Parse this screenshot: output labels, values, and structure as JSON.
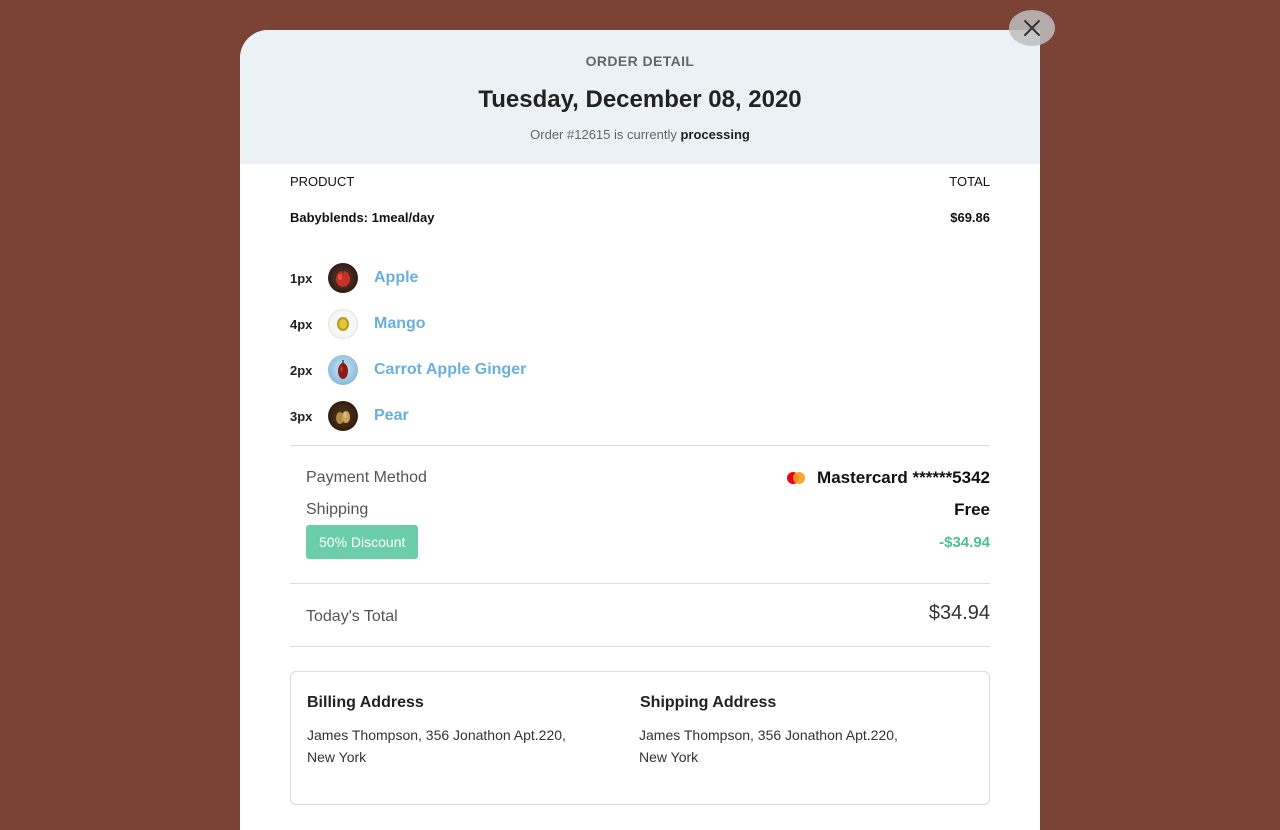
{
  "header": {
    "label": "ORDER DETAIL",
    "date": "Tuesday, December 08, 2020",
    "status_prefix": "Order #12615 is currently",
    "status": "processing"
  },
  "table": {
    "col_product": "PRODUCT",
    "col_total": "TOTAL",
    "product_name": "Babyblends: 1meal/day",
    "product_total": "$69.86"
  },
  "items": [
    {
      "qty": "1px",
      "name": "Apple",
      "icon": "apple-icon"
    },
    {
      "qty": "4px",
      "name": "Mango",
      "icon": "mango-icon"
    },
    {
      "qty": "2px",
      "name": "Carrot Apple Ginger",
      "icon": "carrot-icon"
    },
    {
      "qty": "3px",
      "name": "Pear",
      "icon": "pear-icon"
    }
  ],
  "summary": {
    "payment_label": "Payment Method",
    "payment_brand": "Mastercard",
    "payment_number": "******5342",
    "shipping_label": "Shipping",
    "shipping_value": "Free",
    "discount_label": "50% Discount",
    "discount_value": "-$34.94",
    "total_label": "Today's Total",
    "total_value": "$34.94"
  },
  "addresses": {
    "billing_title": "Billing Address",
    "billing_text": "James Thompson, 356 Jonathon Apt.220, New York",
    "shipping_title": "Shipping Address",
    "shipping_text": "James Thompson, 356 Jonathon Apt.220, New York"
  },
  "colors": {
    "backdrop": "#7b4236",
    "header_bg": "#ebf2f6",
    "link": "#6ab0de",
    "discount": "#6ccda9",
    "discount_text": "#4fbf92"
  }
}
